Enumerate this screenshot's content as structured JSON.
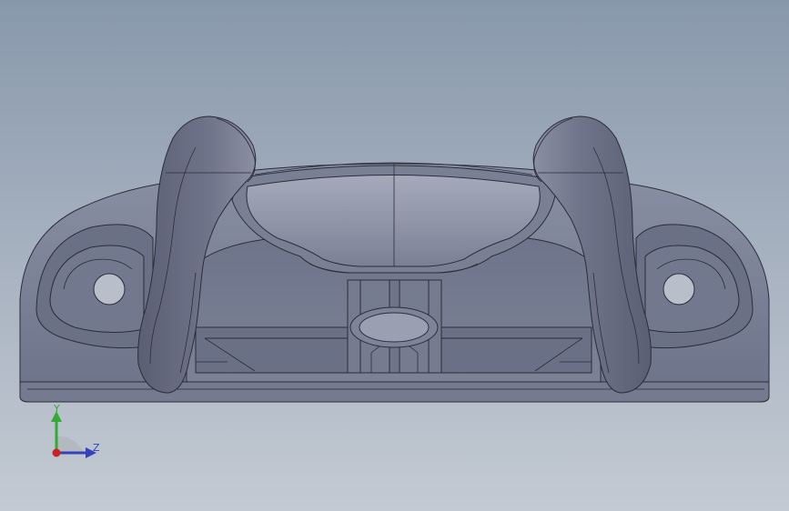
{
  "viewport": {
    "background_top": "#8898ab",
    "background_bottom": "#c3cad3"
  },
  "model": {
    "body_color": "#777d92",
    "shade_color": "#5c6178",
    "highlight_color": "#a3a8ba",
    "edge_color": "#2b2d3a"
  },
  "triad": {
    "y_label": "Y",
    "z_label": "Z",
    "y_color": "#33aa33",
    "z_color": "#3344bb",
    "origin_color": "#cc2222"
  }
}
